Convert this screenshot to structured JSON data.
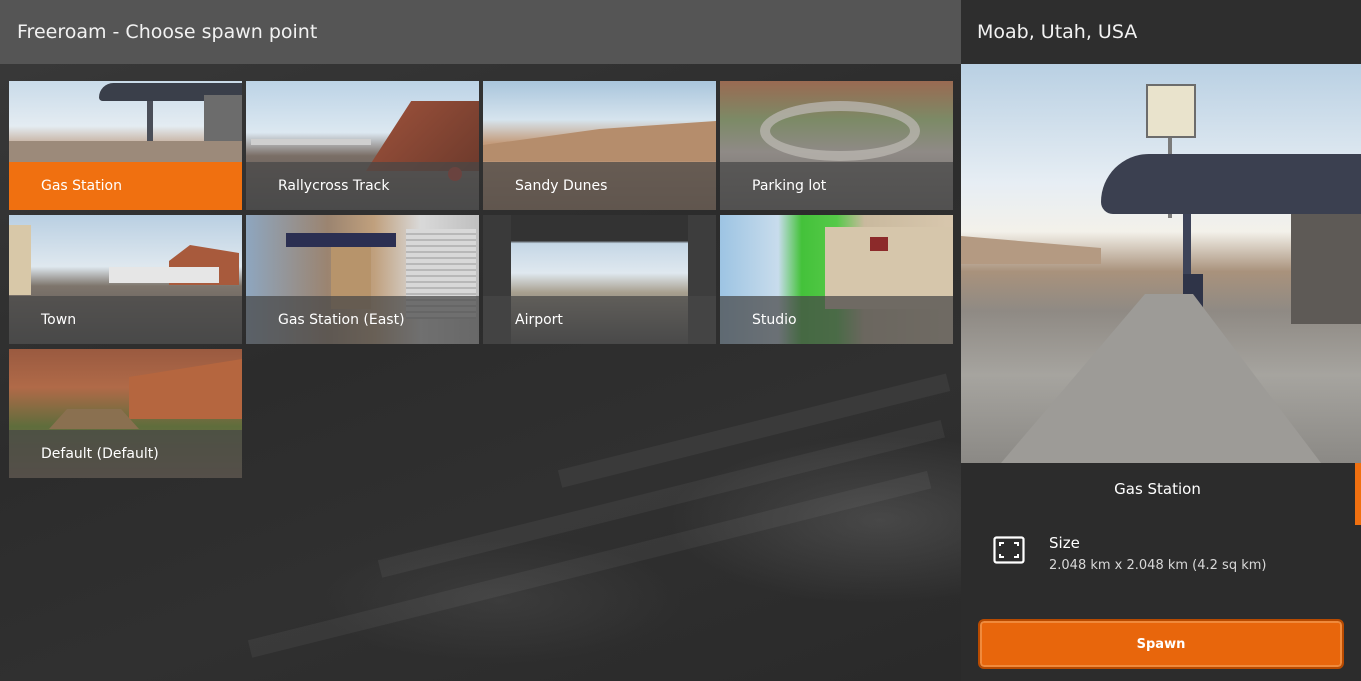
{
  "header": {
    "title": "Freeroam - Choose spawn point"
  },
  "spawn_points": [
    {
      "label": "Gas Station",
      "selected": true
    },
    {
      "label": "Rallycross Track",
      "selected": false
    },
    {
      "label": "Sandy Dunes",
      "selected": false
    },
    {
      "label": "Parking lot",
      "selected": false
    },
    {
      "label": "Town",
      "selected": false
    },
    {
      "label": "Gas Station (East)",
      "selected": false
    },
    {
      "label": "Airport",
      "selected": false
    },
    {
      "label": "Studio",
      "selected": false
    },
    {
      "label": "Default (Default)",
      "selected": false
    }
  ],
  "details": {
    "level_name": "Moab, Utah, USA",
    "spawn_name": "Gas Station",
    "size_label": "Size",
    "size_value": "2.048 km x 2.048 km (4.2 sq km)",
    "spawn_button": "Spawn"
  },
  "colors": {
    "accent": "#f07010",
    "header_bg": "#555555",
    "panel_bg": "#2c2c2c"
  },
  "icons": {
    "size": "expand-frame-icon"
  }
}
